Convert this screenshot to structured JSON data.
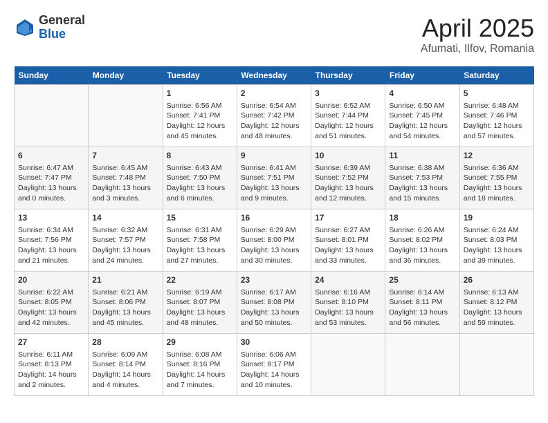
{
  "logo": {
    "general": "General",
    "blue": "Blue"
  },
  "title": "April 2025",
  "location": "Afumati, Ilfov, Romania",
  "days_of_week": [
    "Sunday",
    "Monday",
    "Tuesday",
    "Wednesday",
    "Thursday",
    "Friday",
    "Saturday"
  ],
  "weeks": [
    [
      {
        "day": "",
        "info": ""
      },
      {
        "day": "",
        "info": ""
      },
      {
        "day": "1",
        "info": "Sunrise: 6:56 AM\nSunset: 7:41 PM\nDaylight: 12 hours\nand 45 minutes."
      },
      {
        "day": "2",
        "info": "Sunrise: 6:54 AM\nSunset: 7:42 PM\nDaylight: 12 hours\nand 48 minutes."
      },
      {
        "day": "3",
        "info": "Sunrise: 6:52 AM\nSunset: 7:44 PM\nDaylight: 12 hours\nand 51 minutes."
      },
      {
        "day": "4",
        "info": "Sunrise: 6:50 AM\nSunset: 7:45 PM\nDaylight: 12 hours\nand 54 minutes."
      },
      {
        "day": "5",
        "info": "Sunrise: 6:48 AM\nSunset: 7:46 PM\nDaylight: 12 hours\nand 57 minutes."
      }
    ],
    [
      {
        "day": "6",
        "info": "Sunrise: 6:47 AM\nSunset: 7:47 PM\nDaylight: 13 hours\nand 0 minutes."
      },
      {
        "day": "7",
        "info": "Sunrise: 6:45 AM\nSunset: 7:48 PM\nDaylight: 13 hours\nand 3 minutes."
      },
      {
        "day": "8",
        "info": "Sunrise: 6:43 AM\nSunset: 7:50 PM\nDaylight: 13 hours\nand 6 minutes."
      },
      {
        "day": "9",
        "info": "Sunrise: 6:41 AM\nSunset: 7:51 PM\nDaylight: 13 hours\nand 9 minutes."
      },
      {
        "day": "10",
        "info": "Sunrise: 6:39 AM\nSunset: 7:52 PM\nDaylight: 13 hours\nand 12 minutes."
      },
      {
        "day": "11",
        "info": "Sunrise: 6:38 AM\nSunset: 7:53 PM\nDaylight: 13 hours\nand 15 minutes."
      },
      {
        "day": "12",
        "info": "Sunrise: 6:36 AM\nSunset: 7:55 PM\nDaylight: 13 hours\nand 18 minutes."
      }
    ],
    [
      {
        "day": "13",
        "info": "Sunrise: 6:34 AM\nSunset: 7:56 PM\nDaylight: 13 hours\nand 21 minutes."
      },
      {
        "day": "14",
        "info": "Sunrise: 6:32 AM\nSunset: 7:57 PM\nDaylight: 13 hours\nand 24 minutes."
      },
      {
        "day": "15",
        "info": "Sunrise: 6:31 AM\nSunset: 7:58 PM\nDaylight: 13 hours\nand 27 minutes."
      },
      {
        "day": "16",
        "info": "Sunrise: 6:29 AM\nSunset: 8:00 PM\nDaylight: 13 hours\nand 30 minutes."
      },
      {
        "day": "17",
        "info": "Sunrise: 6:27 AM\nSunset: 8:01 PM\nDaylight: 13 hours\nand 33 minutes."
      },
      {
        "day": "18",
        "info": "Sunrise: 6:26 AM\nSunset: 8:02 PM\nDaylight: 13 hours\nand 36 minutes."
      },
      {
        "day": "19",
        "info": "Sunrise: 6:24 AM\nSunset: 8:03 PM\nDaylight: 13 hours\nand 39 minutes."
      }
    ],
    [
      {
        "day": "20",
        "info": "Sunrise: 6:22 AM\nSunset: 8:05 PM\nDaylight: 13 hours\nand 42 minutes."
      },
      {
        "day": "21",
        "info": "Sunrise: 6:21 AM\nSunset: 8:06 PM\nDaylight: 13 hours\nand 45 minutes."
      },
      {
        "day": "22",
        "info": "Sunrise: 6:19 AM\nSunset: 8:07 PM\nDaylight: 13 hours\nand 48 minutes."
      },
      {
        "day": "23",
        "info": "Sunrise: 6:17 AM\nSunset: 8:08 PM\nDaylight: 13 hours\nand 50 minutes."
      },
      {
        "day": "24",
        "info": "Sunrise: 6:16 AM\nSunset: 8:10 PM\nDaylight: 13 hours\nand 53 minutes."
      },
      {
        "day": "25",
        "info": "Sunrise: 6:14 AM\nSunset: 8:11 PM\nDaylight: 13 hours\nand 56 minutes."
      },
      {
        "day": "26",
        "info": "Sunrise: 6:13 AM\nSunset: 8:12 PM\nDaylight: 13 hours\nand 59 minutes."
      }
    ],
    [
      {
        "day": "27",
        "info": "Sunrise: 6:11 AM\nSunset: 8:13 PM\nDaylight: 14 hours\nand 2 minutes."
      },
      {
        "day": "28",
        "info": "Sunrise: 6:09 AM\nSunset: 8:14 PM\nDaylight: 14 hours\nand 4 minutes."
      },
      {
        "day": "29",
        "info": "Sunrise: 6:08 AM\nSunset: 8:16 PM\nDaylight: 14 hours\nand 7 minutes."
      },
      {
        "day": "30",
        "info": "Sunrise: 6:06 AM\nSunset: 8:17 PM\nDaylight: 14 hours\nand 10 minutes."
      },
      {
        "day": "",
        "info": ""
      },
      {
        "day": "",
        "info": ""
      },
      {
        "day": "",
        "info": ""
      }
    ]
  ]
}
